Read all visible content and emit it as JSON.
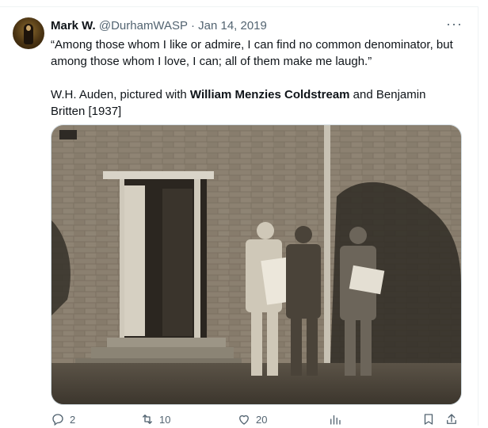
{
  "author": {
    "name": "Mark W.",
    "handle": "@DurhamWASP",
    "separator": "·",
    "date": "Jan 14, 2019"
  },
  "tweet": {
    "quote": "“Among those whom I like or admire, I can find no common denominator, but among those whom I love, I can; all of them make me laugh.”",
    "caption_prefix": "W.H. Auden, pictured with ",
    "caption_bold": "William Menzies Coldstream",
    "caption_suffix": " and Benjamin Britten [1937]"
  },
  "more_menu": "···",
  "metrics": {
    "replies": "2",
    "retweets": "10",
    "likes": "20"
  },
  "icons": [
    "reply-icon",
    "retweet-icon",
    "like-icon",
    "views-icon",
    "bookmark-icon",
    "share-icon",
    "more-options-icon"
  ],
  "colors": {
    "text_primary": "#0f1419",
    "text_secondary": "#536471",
    "border": "#cfd9de"
  }
}
